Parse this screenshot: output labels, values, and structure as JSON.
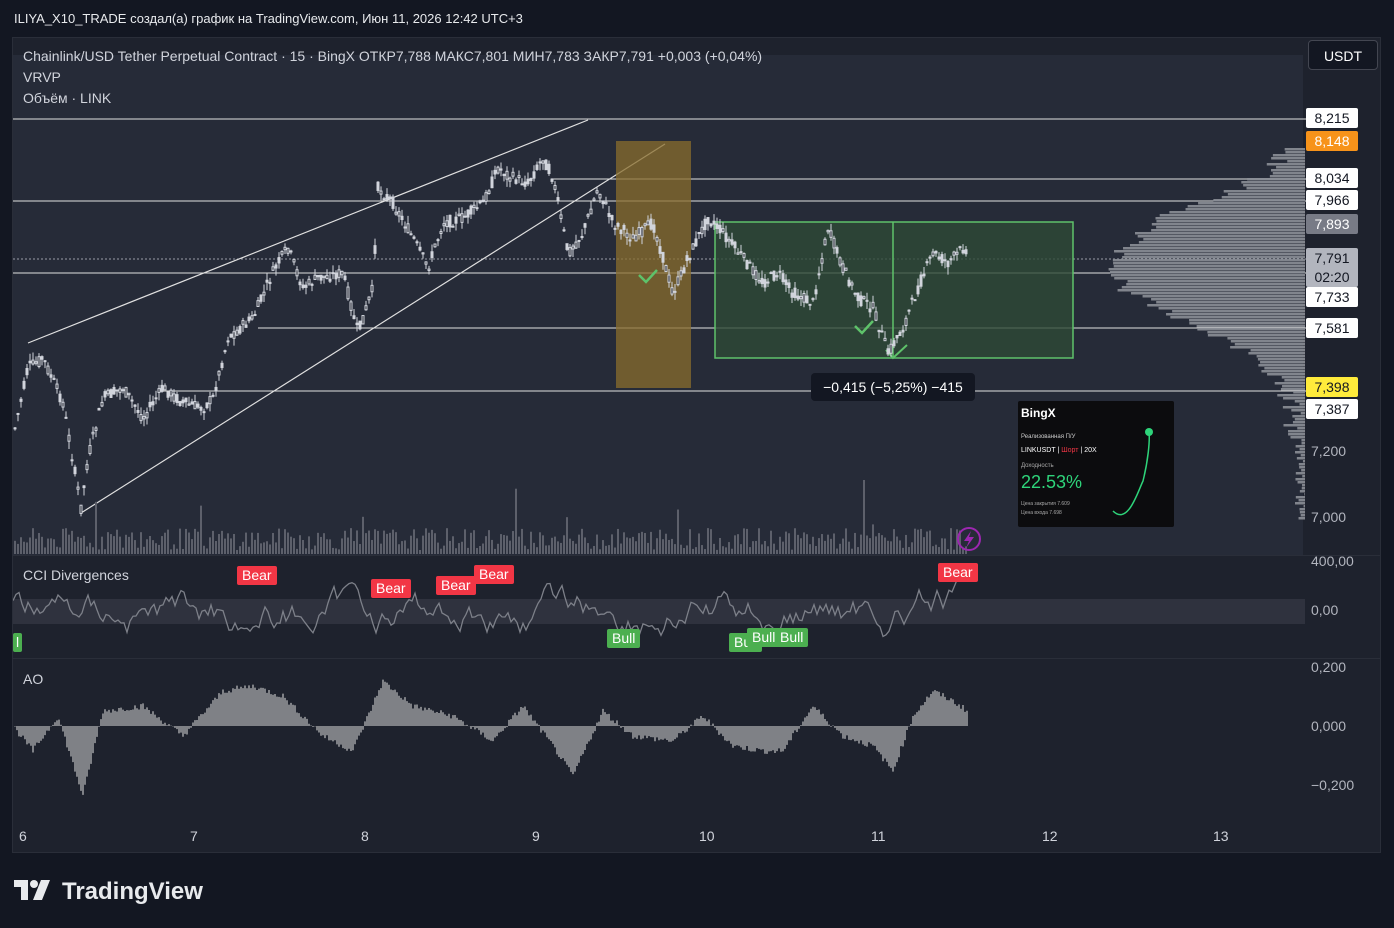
{
  "header": {
    "attribution": "ILIYA_X10_TRADE создал(а) график на TradingView.com, Июн 11, 2026 12:42 UTC+3"
  },
  "chart": {
    "title_line": "Chainlink/USD Tether Perpetual Contract · 15 · BingX  ОТКР7,788  МАКС7,801  МИН7,783  ЗАКР7,791  +0,003 (+0,04%)",
    "indicator_vrvp": "VRVP",
    "indicator_volume": "Объём · LINK",
    "currency_button": "USDT",
    "price_labels": [
      {
        "value": "8,215",
        "style": "white"
      },
      {
        "value": "8,148",
        "style": "orange"
      },
      {
        "value": "8,034",
        "style": "white"
      },
      {
        "value": "7,966",
        "style": "white"
      },
      {
        "value": "7,893",
        "style": "gray"
      },
      {
        "value": "7,791",
        "style": "gray-top"
      },
      {
        "value": "02:20",
        "style": "gray-bottom"
      },
      {
        "value": "7,733",
        "style": "white"
      },
      {
        "value": "7,581",
        "style": "white"
      },
      {
        "value": "7,398",
        "style": "yellow"
      },
      {
        "value": "7,387",
        "style": "white"
      }
    ],
    "axis_labels": [
      "7,200",
      "7,000"
    ],
    "measure_tooltip": "−0,415 (−5,25%) −415",
    "x_labels": [
      "6",
      "7",
      "8",
      "9",
      "10",
      "11",
      "12",
      "13"
    ]
  },
  "cci": {
    "label": "CCI Divergences",
    "axis": [
      "400,00",
      "0,00"
    ],
    "bear_tags": [
      "Bear",
      "Bear",
      "Bear",
      "Bear",
      "Bear"
    ],
    "bull_tags": [
      "Bull",
      "Bull",
      "Bull",
      "Bull"
    ],
    "bull_partial": "l"
  },
  "ao": {
    "label": "AO",
    "axis": [
      "0,200",
      "0,000",
      "−0,200"
    ]
  },
  "bingx_card": {
    "logo": "BingX",
    "realized": "Реализованная П/У",
    "pair": "LINKUSDT",
    "side": "Шорт",
    "leverage": "20X",
    "yield_label": "Доходность",
    "yield_value": "22.53%",
    "close_price": "Цена закрытия    7.609",
    "entry_price": "Цена входа    7.698"
  },
  "footer": {
    "brand": "TradingView"
  },
  "colors": {
    "background": "#131722",
    "pane": "#1e222d",
    "bear": "#f23645",
    "bull": "#4caf50",
    "orange_label": "#f7931a",
    "yellow_label": "#ffeb3b",
    "green_zone": "#4caf50"
  }
}
